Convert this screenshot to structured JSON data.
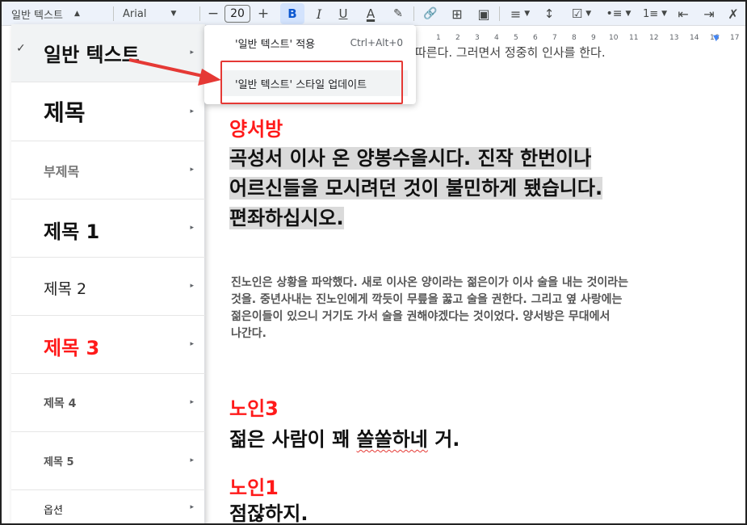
{
  "toolbar": {
    "style_select": "일반 텍스트",
    "font_select": "Arial",
    "font_size": "20",
    "buttons": {
      "minus": "−",
      "plus": "+",
      "bold": "B",
      "italic": "I",
      "underline": "U",
      "text_color": "A",
      "highlight": "✎",
      "link": "🔗",
      "comment": "⊞",
      "image": "▣",
      "align": "≡",
      "line_spacing": "↕",
      "checklist": "☑",
      "bullets": "•≡",
      "numbered": "1≡",
      "indent_decrease": "⇤",
      "indent_increase": "⇥",
      "clear_format": "✗"
    }
  },
  "ruler": {
    "numbers": [
      "1",
      "2",
      "3",
      "4",
      "5",
      "6",
      "7",
      "8",
      "9",
      "10",
      "11",
      "12",
      "13",
      "14",
      "15",
      "16",
      "17"
    ]
  },
  "style_menu": {
    "items": [
      {
        "label": "일반 텍스트",
        "checked": true
      },
      {
        "label": "제목"
      },
      {
        "label": "부제목"
      },
      {
        "label": "제목 1"
      },
      {
        "label": "제목 2"
      },
      {
        "label": "제목 3"
      },
      {
        "label": "제목 4"
      },
      {
        "label": "제목 5"
      },
      {
        "label": "옵션"
      }
    ],
    "check_icon": "✓",
    "arrow_icon": "▸"
  },
  "submenu": {
    "apply_label": "'일반 텍스트' 적용",
    "apply_shortcut": "Ctrl+Alt+0",
    "update_label": "'일반 텍스트' 스타일 업데이트"
  },
  "document": {
    "top_line": "따른다. 그러면서 정중히 인사를 한다.",
    "speaker1": "양서방",
    "dialog1": [
      "곡성서 이사 온 양봉수올시다. 진작 한번이나",
      "어르신들을 모시려던 것이 불민하게 됐습니다.",
      "편좌하십시오."
    ],
    "narration": [
      "진노인은 상황을 파악했다. 새로 이사온 양이라는 젊은이가 이사 술을 내는 것이라는",
      "것을. 중년사내는 진노인에게 깍듯이 무릎을 꿇고 술을 권한다. 그리고 옆 사랑에는",
      "젊은이들이 있으니 거기도 가서 술을 권해야겠다는 것이었다. 양서방은 무대에서",
      "나간다."
    ],
    "speaker2": "노인3",
    "dialog2_a": "젊은 사람이 꽤 ",
    "dialog2_b": "쏠쏠하네",
    "dialog2_c": " 거.",
    "speaker3": "노인1",
    "dialog3": "점잖하지."
  }
}
